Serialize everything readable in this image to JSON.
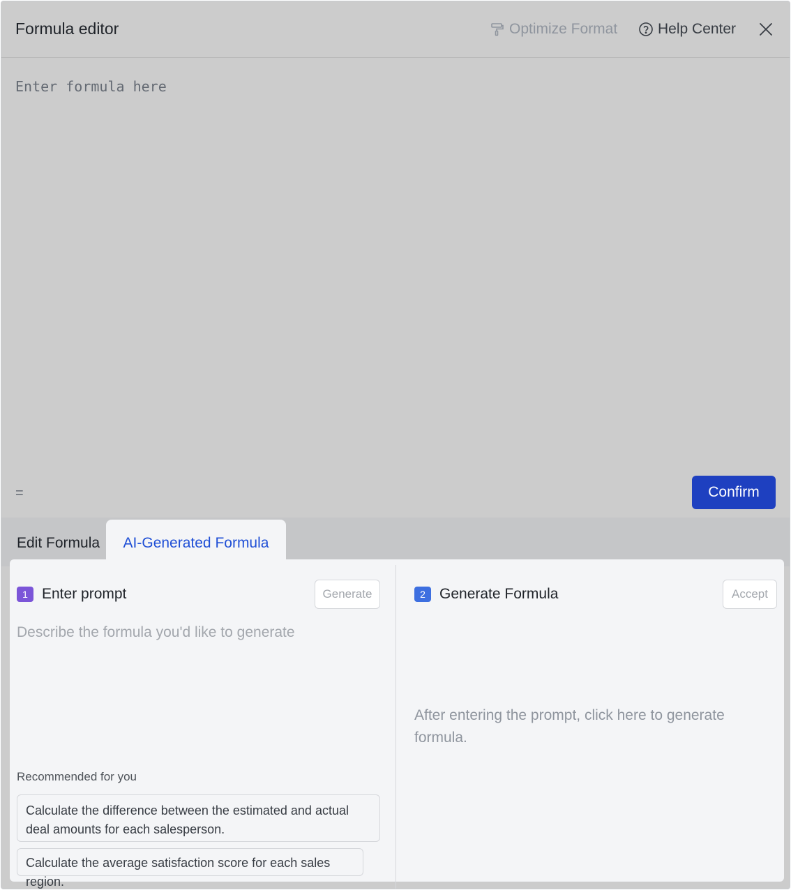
{
  "header": {
    "title": "Formula editor",
    "optimize_label": "Optimize Format",
    "help_label": "Help Center",
    "close_icon": "close-icon",
    "optimize_icon": "paint-roller-icon",
    "help_icon": "question-circle-icon"
  },
  "editor": {
    "placeholder": "Enter formula here",
    "value": "",
    "equals": "=",
    "confirm_label": "Confirm"
  },
  "tabs": [
    {
      "label": "Edit Formula",
      "active": false
    },
    {
      "label": "AI-Generated Formula",
      "active": true
    }
  ],
  "ai": {
    "step1": {
      "number": "1",
      "title": "Enter prompt",
      "button_label": "Generate",
      "placeholder": "Describe the formula you'd like to generate"
    },
    "step2": {
      "number": "2",
      "title": "Generate Formula",
      "button_label": "Accept",
      "hint": "After entering the prompt, click here to generate formula."
    },
    "recommended_label": "Recommended for you",
    "recommendations": [
      "Calculate the difference between the estimated and actual deal amounts for each salesperson.",
      "Calculate the average satisfaction score for each sales region."
    ]
  },
  "colors": {
    "accent": "#1e40c0",
    "tab_active": "#1f4fd6",
    "badge1": "#7b55d8",
    "badge2": "#3d6fe0"
  }
}
